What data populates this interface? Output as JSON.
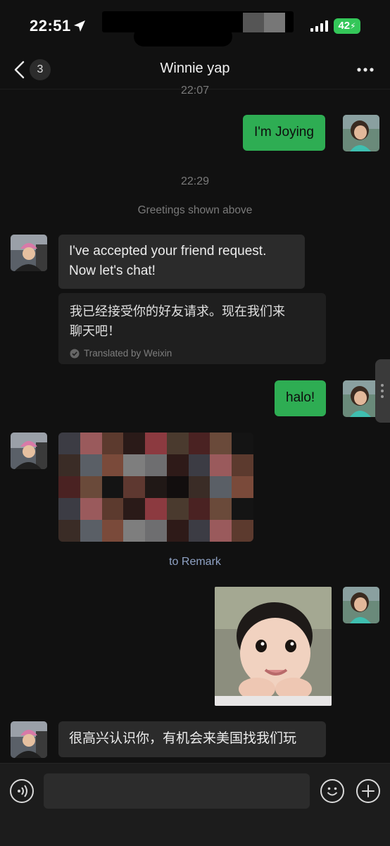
{
  "status_bar": {
    "time": "22:51",
    "battery": "42"
  },
  "nav": {
    "back_count": "3",
    "title": "Winnie yap"
  },
  "messages": {
    "ts1": "22:07",
    "sent1": "I'm Joying",
    "ts2": "22:29",
    "greet_note": "Greetings shown above",
    "recv1_line1": "I've accepted your friend request.",
    "recv1_line2": "Now let's chat!",
    "trans_line1": "我已经接受你的好友请求。现在我们来",
    "trans_line2": "聊天吧！",
    "trans_label": "Translated by Weixin",
    "sent2": "halo!",
    "remark_link": "to Remark",
    "recv2": "很高兴认识你，有机会来美国找我们玩"
  },
  "colors": {
    "sent_bubble": "#2ead53",
    "recv_bubble": "#2b2b2b",
    "background": "#111111"
  }
}
